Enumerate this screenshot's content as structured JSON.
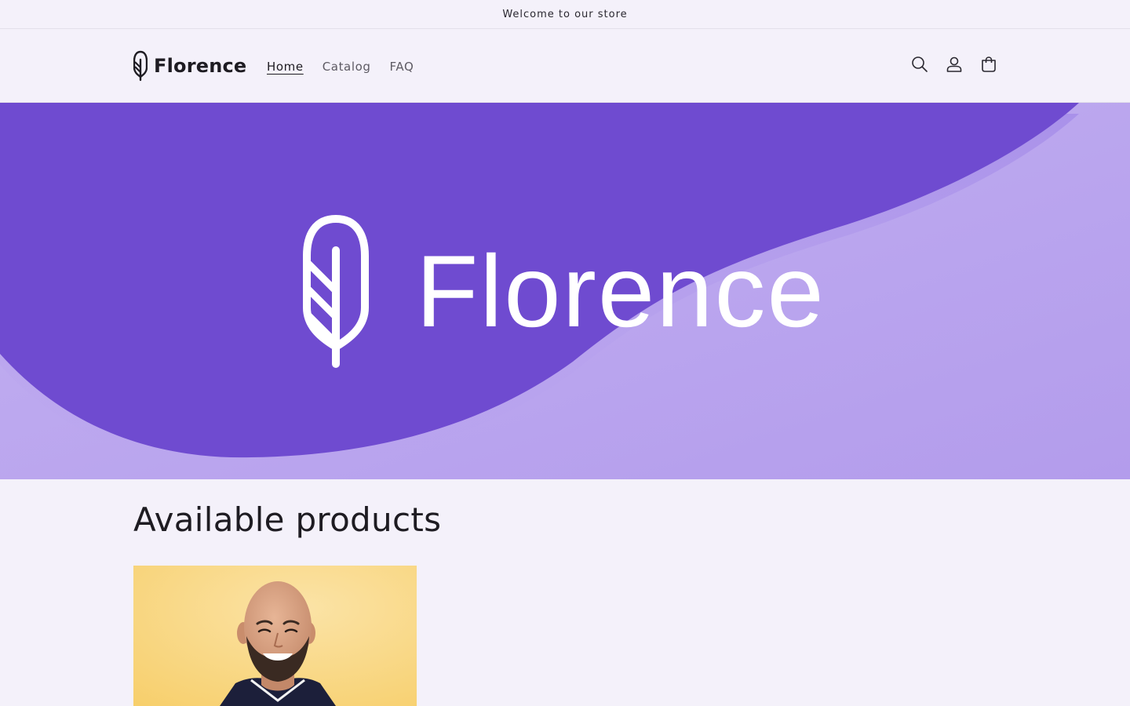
{
  "announcement": {
    "text": "Welcome to our store"
  },
  "header": {
    "logo_text": "Florence",
    "nav": [
      {
        "label": "Home",
        "active": true
      },
      {
        "label": "Catalog",
        "active": false
      },
      {
        "label": "FAQ",
        "active": false
      }
    ],
    "icons": [
      "search-icon",
      "account-icon",
      "cart-icon"
    ]
  },
  "hero": {
    "brand_text": "Florence",
    "colors": {
      "dark": "#6f4bd0",
      "light": "#b9a4ee"
    }
  },
  "products": {
    "title": "Available products",
    "items": [
      {
        "image": "smiling-man-portrait"
      }
    ]
  }
}
